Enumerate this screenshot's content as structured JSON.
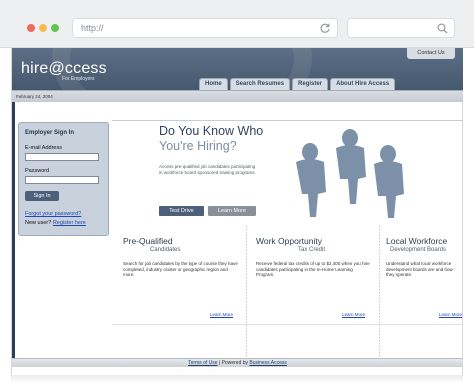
{
  "browser": {
    "url": "http://"
  },
  "header": {
    "logo": "hire@ccess",
    "logo_sub": "For Employers",
    "contact": "Contact Us",
    "nav": [
      "Home",
      "Search Resumes",
      "Register",
      "About Hire Access"
    ],
    "date": "February 24, 2004"
  },
  "signin": {
    "title": "Employer Sign In",
    "email_label": "E-mail Address",
    "password_label": "Password",
    "button": "Sign In",
    "forgot": "Forgot your password?",
    "new_user": "New user?",
    "register": "Register here"
  },
  "hero": {
    "title1": "Do You Know Who",
    "title2": "You're Hiring?",
    "desc": "Access pre-qualified job candidates participating in workforce board sponsored training programs.",
    "test_drive": "Test Drive",
    "learn_more": "Learn More"
  },
  "columns": [
    {
      "title": "Pre-Qualified",
      "sub": "Candidates",
      "body": "Search for job candidates by the type of course they have completed, industry cluster or geographic region and more.",
      "link": "Learn More"
    },
    {
      "title": "Work Opportunity",
      "sub": "Tax Credit",
      "body": "Receive federal tax credits of up to $2,400 when you hire candidates participating in the In-Home Learning Program.",
      "link": "Learn More"
    },
    {
      "title": "Local Workforce",
      "sub": "Development Boards",
      "body": "Understand what local workforce development boards are and how they operate.",
      "link": "Learn More"
    }
  ],
  "footer": {
    "terms": "Terms of Use",
    "powered": "| Powered by",
    "brand": "Business Access"
  }
}
